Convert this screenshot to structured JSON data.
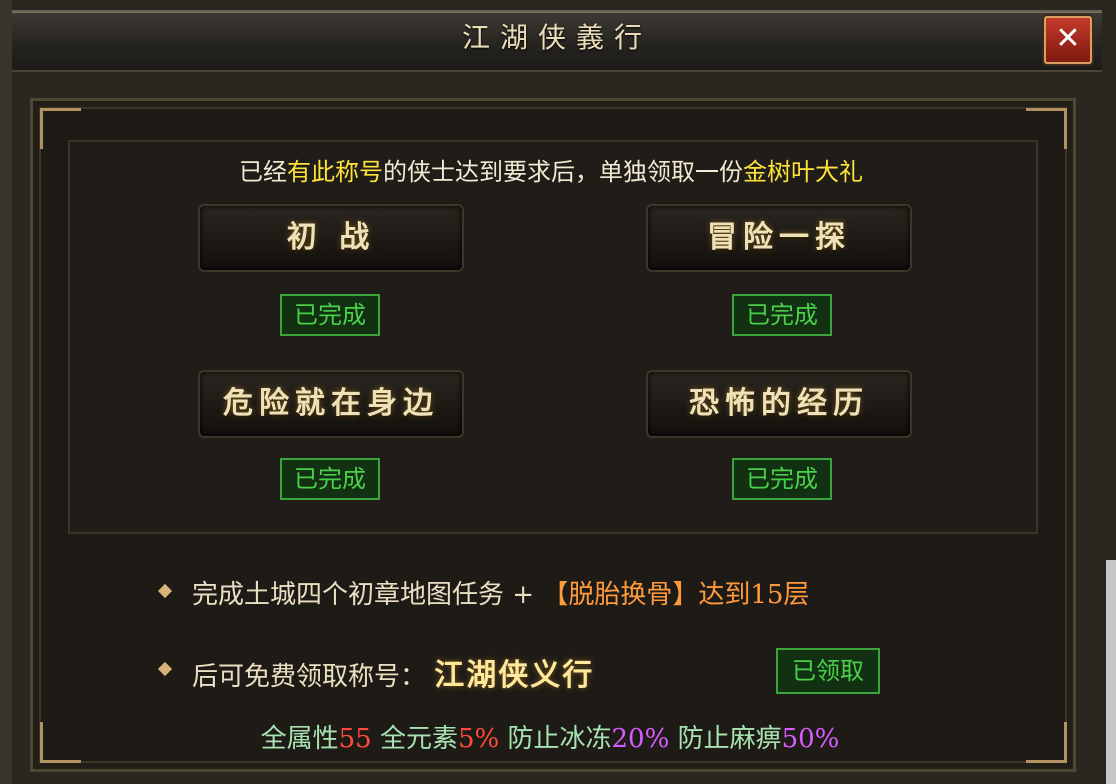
{
  "window": {
    "title": "江湖侠義行",
    "close_glyph": "✕"
  },
  "intro": {
    "part1": "已经",
    "highlight1": "有此称号",
    "part2": "的侠士达到要求后，单独领取一份",
    "highlight2": "金树叶大礼"
  },
  "quests": [
    {
      "name": "初  战",
      "status": "已完成"
    },
    {
      "name": "冒险一探",
      "status": "已完成"
    },
    {
      "name": "危险就在身边",
      "status": "已完成"
    },
    {
      "name": "恐怖的经历",
      "status": "已完成"
    }
  ],
  "requirement": {
    "text": "完成土城四个初章地图任务 + ",
    "bracket": "【脱胎换骨】",
    "suffix": "达到15层"
  },
  "reward": {
    "prefix": "后可免费领取称号：",
    "title_name": "江湖侠义行",
    "claimed_label": "已领取"
  },
  "stats": [
    {
      "label": "全属性",
      "value": "55"
    },
    {
      "label": "全元素",
      "value": "5%"
    },
    {
      "label": "防止冰冻",
      "value": "20%"
    },
    {
      "label": "防止麻痹",
      "value": "50%"
    }
  ],
  "colors": {
    "highlight_yellow": "#ffe23c",
    "done_green": "#4ad14a",
    "bracket_orange": "#ff9a3c",
    "stat_red": "#ff4a3a",
    "stat_purple": "#d95aff"
  }
}
